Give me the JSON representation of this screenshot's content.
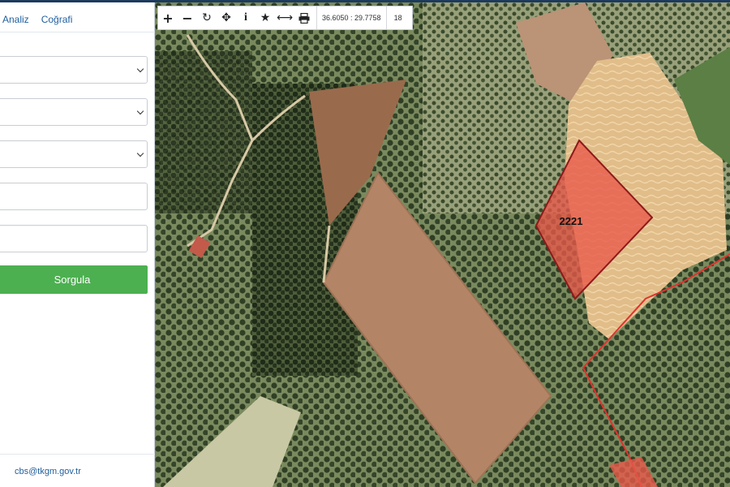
{
  "sidebar": {
    "tabs": [
      "Analiz",
      "Coğrafi"
    ],
    "submit_label": "Sorgula",
    "contact_email": "cbs@tkgm.gov.tr"
  },
  "toolbar": {
    "tools": [
      "plus-icon",
      "minus-icon",
      "refresh-icon",
      "pan-icon",
      "info-icon",
      "star-icon",
      "measure-icon",
      "print-icon"
    ],
    "coordinates": "36.6050 : 29.7758",
    "zoom_level": "18"
  },
  "map": {
    "parcel_number": "2221",
    "parcel_color": "#e8594a",
    "parcel_outline": "#8e1a1a",
    "boundary_color": "#e0332f"
  }
}
